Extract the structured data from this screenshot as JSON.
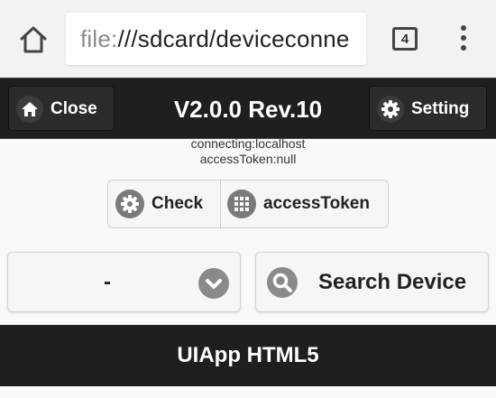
{
  "browser": {
    "url_scheme": "file:",
    "url_rest": "///sdcard/deviceconne",
    "tab_count": "4",
    "icons": {
      "home": "home-icon",
      "tabs": "tabs-icon",
      "menu": "more-vert-icon"
    }
  },
  "header": {
    "close_label": "Close",
    "title": "V2.0.0 Rev.10",
    "setting_label": "Setting",
    "icons": {
      "close": "home-icon",
      "setting": "gear-icon"
    }
  },
  "status": {
    "connecting": "connecting:localhost",
    "access_token": "accessToken:null"
  },
  "actions": {
    "check_label": "Check",
    "access_token_label": "accessToken",
    "icons": {
      "check": "gear-icon",
      "access_token": "grid-icon"
    }
  },
  "device_select": {
    "value": "-",
    "icon": "chevron-down-icon"
  },
  "search": {
    "label": "Search Device",
    "icon": "search-icon"
  },
  "footer": {
    "title": "UIApp HTML5"
  },
  "colors": {
    "header_bg": "#1f1f1f",
    "page_bg": "#f9f9f9",
    "button_bg": "#f6f6f6",
    "icon_circle_dark": "#3c3c3c",
    "icon_circle_light": "#8a8a8a"
  }
}
